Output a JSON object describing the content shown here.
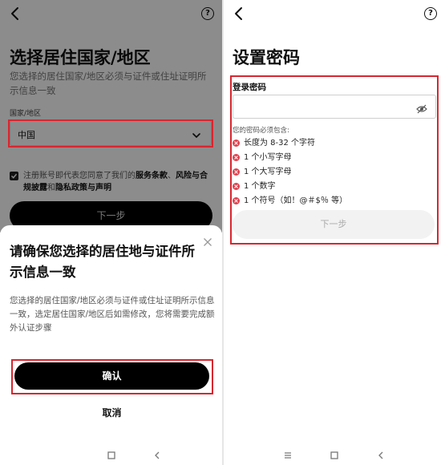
{
  "left": {
    "title": "选择居住国家/地区",
    "description": "您选择的居住国家/地区必须与证件或住址证明所示信息一致",
    "country_label": "国家/地区",
    "country_value": "中国",
    "agree_prefix": "注册账号即代表您同意了我们的",
    "terms_link": "服务条款",
    "agree_mid": "、",
    "risk_link": "风险与合规披露",
    "agree_and": "和",
    "privacy_link": "隐私政策与声明",
    "next_label": "下一步",
    "sheet": {
      "title": "请确保您选择的居住地与证件所示信息一致",
      "description": "您选择的居住国家/地区必须与证件或住址证明所示信息一致，选定居住国家/地区后如需修改，您将需要完成额外认证步骤",
      "confirm_label": "确认",
      "cancel_label": "取消"
    }
  },
  "right": {
    "title": "设置密码",
    "password_label": "登录密码",
    "password_value": "",
    "requirements_title": "您的密码必须包含:",
    "requirements": [
      "长度为 8-32 个字符",
      "1 个小写字母",
      "1 个大写字母",
      "1 个数字",
      "1 个符号（如！@＃$％ 等）"
    ],
    "next_label": "下一步"
  },
  "colors": {
    "highlight": "#d8262f",
    "error_dot": "#e0414e",
    "primary_button": "#000000"
  },
  "icons": [
    "back-arrow-icon",
    "help-icon",
    "chevron-down-icon",
    "checkbox-checked-icon",
    "close-icon",
    "eye-off-icon",
    "menu-icon",
    "home-square-icon",
    "nav-back-icon",
    "error-x-icon"
  ]
}
